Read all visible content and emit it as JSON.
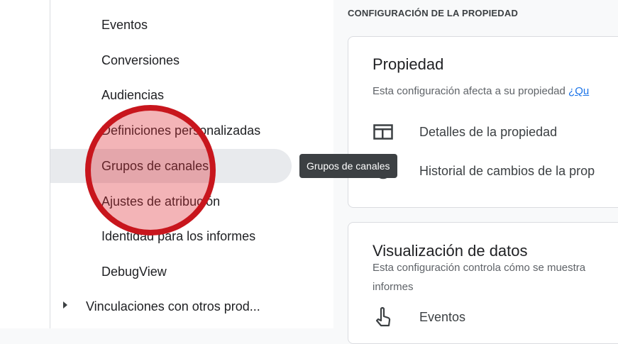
{
  "nav": {
    "items": [
      {
        "label": "Eventos"
      },
      {
        "label": "Conversiones"
      },
      {
        "label": "Audiencias"
      },
      {
        "label": "Definiciones personalizadas"
      },
      {
        "label": "Grupos de canales",
        "selected": true
      },
      {
        "label": "Ajustes de atribución"
      },
      {
        "label": "Identidad para los informes"
      },
      {
        "label": "DebugView"
      }
    ],
    "group_item": {
      "label": "Vinculaciones con otros prod..."
    }
  },
  "tooltip": {
    "text": "Grupos de canales"
  },
  "main": {
    "section_title": "CONFIGURACIÓN DE LA PROPIEDAD",
    "property_card": {
      "title": "Propiedad",
      "description": "Esta configuración afecta a su propiedad",
      "link": "¿Qu",
      "rows": [
        {
          "label": "Detalles de la propiedad",
          "icon": "property-details-icon"
        },
        {
          "label": "Historial de cambios de la prop",
          "icon": "history-icon"
        }
      ]
    },
    "data_display_card": {
      "title": "Visualización de datos",
      "description_line1": "Esta configuración controla cómo se muestra",
      "description_line2": "informes",
      "rows": [
        {
          "label": "Eventos",
          "icon": "touch-icon"
        }
      ]
    }
  },
  "colors": {
    "highlight_border": "#c8161d",
    "selected_bg": "#e8eaed",
    "link": "#1a73e8",
    "tooltip_bg": "#3c4043"
  }
}
